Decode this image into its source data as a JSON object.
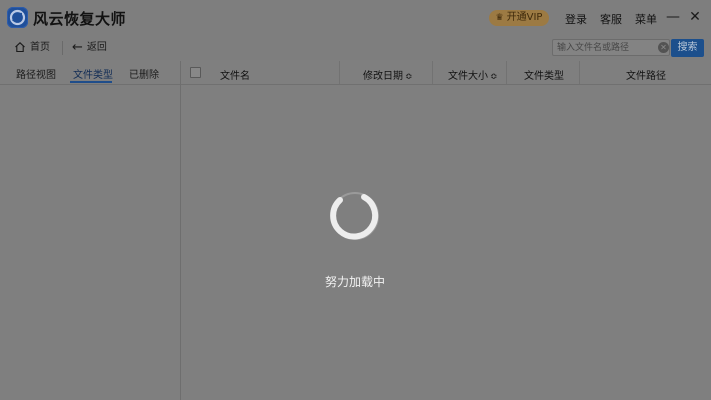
{
  "window": {
    "title": "风云恢复大师",
    "vip_label": "开通VIP",
    "login": "登录",
    "service": "客服",
    "menu": "菜单",
    "minimize_glyph": "—",
    "close_glyph": "✕"
  },
  "toolbar": {
    "home_label": "首页",
    "back_label": "返回",
    "back_glyph": "←",
    "search_placeholder": "输入文件名或路径",
    "search_label": "搜索",
    "clear_glyph": "✕"
  },
  "left_tabs": [
    {
      "label": "路径视图"
    },
    {
      "label": "文件类型"
    },
    {
      "label": "已删除"
    }
  ],
  "table": {
    "columns": [
      {
        "label": "文件名"
      },
      {
        "label": "修改日期",
        "sort_glyph": "≎"
      },
      {
        "label": "文件大小",
        "sort_glyph": "≎"
      },
      {
        "label": "文件类型"
      },
      {
        "label": "文件路径"
      }
    ]
  },
  "loading": {
    "text": "努力加载中"
  },
  "colors": {
    "brand": "#1f4f9a",
    "accent_button": "#1c4f8c",
    "vip_gold": "#9c7a43",
    "overlay_gray": "#7f7f7f"
  },
  "icons": [
    "app-logo-icon",
    "crown-icon",
    "home-icon",
    "back-arrow-icon",
    "clear-search-icon",
    "loading-spinner-icon"
  ]
}
